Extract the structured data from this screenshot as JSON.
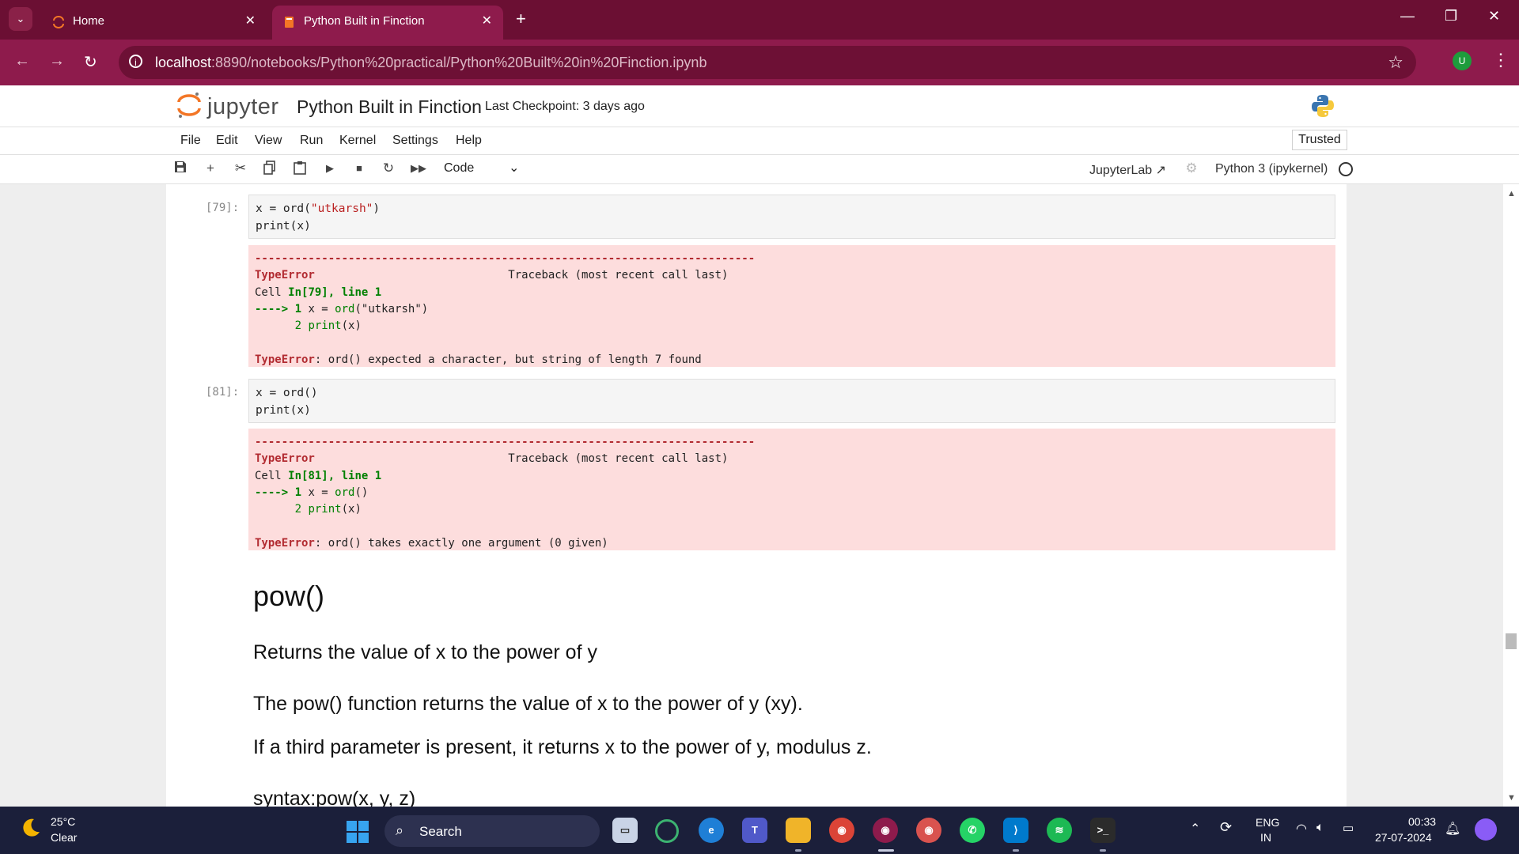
{
  "browser": {
    "tabs": [
      {
        "label": "Home",
        "icon": "jupyter-icon"
      },
      {
        "label": "Python Built in Finction",
        "icon": "notebook-icon"
      }
    ],
    "url_host": "localhost",
    "url_rest": ":8890/notebooks/Python%20practical/Python%20Built%20in%20Finction.ipynb",
    "profile_initial": "U",
    "theme_color": "#8e1b4c"
  },
  "jupyter": {
    "logo_text": "jupyter",
    "notebook_title": "Python Built in Finction",
    "checkpoint": "Last Checkpoint: 3 days ago",
    "menu": [
      "File",
      "Edit",
      "View",
      "Run",
      "Kernel",
      "Settings",
      "Help"
    ],
    "trusted": "Trusted",
    "cell_type": "Code",
    "jupyterlab_link": "JupyterLab",
    "kernel": "Python 3 (ipykernel)"
  },
  "cells": [
    {
      "prompt": "[79]:",
      "code_line1_pre": "x = ord(",
      "code_line1_str": "\"utkarsh\"",
      "code_line1_post": ")",
      "code_line2": "print(x)",
      "tb_sep": "---------------------------------------------------------------------------",
      "tb_type": "TypeError",
      "tb_header": "Traceback (most recent call last)",
      "tb_cell_pre": "Cell ",
      "tb_cell_ref": "In[79], line 1",
      "tb_arrow": "----> 1",
      "tb_line1_pre": " x = ",
      "tb_line1_fn": "ord",
      "tb_line1_rest": "(\"utkarsh\")",
      "tb_line2_num": "2",
      "tb_line2_fn": "print",
      "tb_line2_rest": "(x)",
      "tb_error_type": "TypeError",
      "tb_error_msg": ": ord() expected a character, but string of length 7 found"
    },
    {
      "prompt": "[81]:",
      "code_line1_pre": "x = ord()",
      "code_line1_str": "",
      "code_line1_post": "",
      "code_line2": "print(x)",
      "tb_sep": "---------------------------------------------------------------------------",
      "tb_type": "TypeError",
      "tb_header": "Traceback (most recent call last)",
      "tb_cell_pre": "Cell ",
      "tb_cell_ref": "In[81], line 1",
      "tb_arrow": "----> 1",
      "tb_line1_pre": " x = ",
      "tb_line1_fn": "ord",
      "tb_line1_rest": "()",
      "tb_line2_num": "2",
      "tb_line2_fn": "print",
      "tb_line2_rest": "(x)",
      "tb_error_type": "TypeError",
      "tb_error_msg": ": ord() takes exactly one argument (0 given)"
    }
  ],
  "markdown": {
    "heading": "pow()",
    "p1": "Returns the value of x to the power of y",
    "p2": "The pow() function returns the value of x to the power of y (xy).",
    "p3": "If a third parameter is present, it returns x to the power of y, modulus z.",
    "p4": "syntax:pow(x, y, z)"
  },
  "taskbar": {
    "temperature": "25°C",
    "condition": "Clear",
    "search": "Search",
    "lang1": "ENG",
    "lang2": "IN",
    "time": "00:33",
    "date": "27-07-2024"
  }
}
